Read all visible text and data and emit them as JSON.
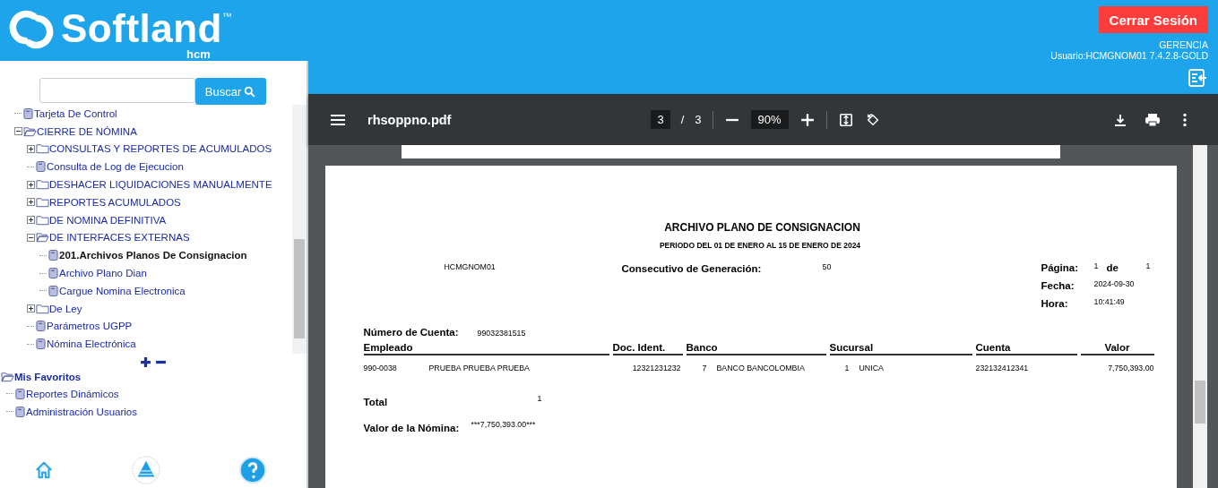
{
  "header": {
    "logo": "Softland",
    "trademark": "™",
    "product": "hcm",
    "logout_button": "Cerrar Sesión",
    "company": "GERENCIA",
    "user_info": "Usuario:HCMGNOM01 7.4.2.8-GOLD"
  },
  "search": {
    "button": "Buscar"
  },
  "menu_tree": [
    {
      "kind": "leaf",
      "label": "Tarjeta De Control",
      "selected": false
    },
    {
      "kind": "folder",
      "label": "CIERRE DE NÓMINA",
      "expanded": true,
      "children": [
        {
          "kind": "folder",
          "label": "CONSULTAS Y REPORTES DE ACUMULADOS",
          "expanded": false
        },
        {
          "kind": "leaf",
          "label": "Consulta de Log de Ejecucion",
          "selected": false
        },
        {
          "kind": "folder",
          "label": "DESHACER LIQUIDACIONES MANUALMENTE",
          "expanded": false
        },
        {
          "kind": "folder",
          "label": "REPORTES ACUMULADOS",
          "expanded": false
        },
        {
          "kind": "folder",
          "label": "DE NOMINA DEFINITIVA",
          "expanded": false
        },
        {
          "kind": "folder",
          "label": "DE INTERFACES EXTERNAS",
          "expanded": true,
          "children": [
            {
              "kind": "leaf",
              "label": "201.Archivos Planos De Consignacion",
              "selected": true
            },
            {
              "kind": "leaf",
              "label": "Archivo Plano Dian",
              "selected": false
            },
            {
              "kind": "leaf",
              "label": "Cargue Nomina Electronica",
              "selected": false
            }
          ]
        },
        {
          "kind": "folder",
          "label": "De Ley",
          "expanded": false
        },
        {
          "kind": "leaf",
          "label": "Parámetros UGPP",
          "selected": false
        },
        {
          "kind": "leaf",
          "label": "Nómina Electrónica",
          "selected": false
        }
      ]
    }
  ],
  "favorites": {
    "label": "Mis Favoritos",
    "expanded": true,
    "items": [
      {
        "label": "Reportes Dinámicos"
      },
      {
        "label": "Administración Usuarios"
      }
    ]
  },
  "pdf_viewer": {
    "file_name": "rhsoppno.pdf",
    "page": "3",
    "page_total": "3",
    "page_separator": "/",
    "zoom": "90%"
  },
  "report": {
    "title": "ARCHIVO PLANO DE CONSIGNACION",
    "subtitle": "PERIODO DEL 01 DE ENERO AL 15 DE ENERO DE 2024",
    "user": "HCMGNOM01",
    "consecutive_label": "Consecutivo de Generación:",
    "consecutive": "50",
    "page_label": "Página:",
    "page": "1",
    "of_label": "de",
    "page_total": "1",
    "date_label": "Fecha:",
    "date": "2024-09-30",
    "time_label": "Hora:",
    "time": "10:41:49",
    "account_label": "Número de Cuenta:",
    "account": "99032381515",
    "columns": [
      "Empleado",
      "Doc. Ident.",
      "Banco",
      "Sucursal",
      "Cuenta",
      "Valor"
    ],
    "rows": [
      {
        "code": "990-0038",
        "name": "PRUEBA  PRUEBA PRUEBA",
        "doc": "12321231232",
        "bank_code": "7",
        "bank": "BANCO BANCOLOMBIA",
        "branch_code": "1",
        "branch": "UNICA",
        "account": "232132412341",
        "value": "7,750,393.00"
      }
    ],
    "total_label": "Total",
    "total": "1",
    "payroll_label": "Valor de la Nómina:",
    "payroll_value": "***7,750,393.00***"
  }
}
